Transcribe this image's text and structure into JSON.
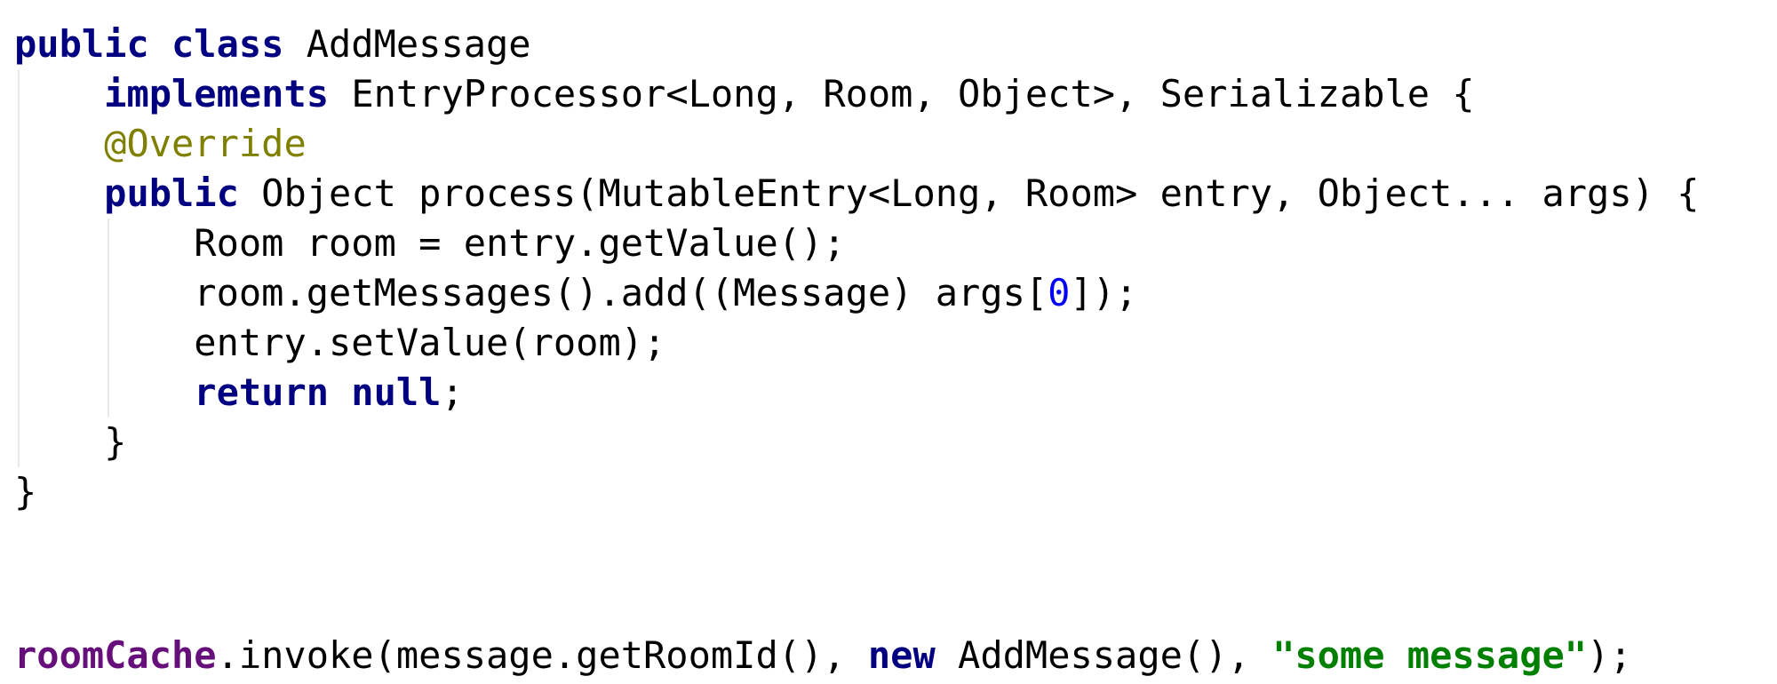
{
  "editor": {
    "theme_colors": {
      "keyword": "#000080",
      "annotation": "#808000",
      "number": "#0000ff",
      "field": "#660e7a",
      "string": "#008000",
      "text": "#000000",
      "background": "#ffffff"
    },
    "class_block": {
      "lines": [
        {
          "tokens": [
            {
              "t": "kw",
              "v": "public class "
            },
            {
              "t": "txt",
              "v": "AddMessage"
            }
          ],
          "indent": 0
        },
        {
          "tokens": [
            {
              "t": "kw",
              "v": "implements "
            },
            {
              "t": "txt",
              "v": "EntryProcessor<Long, Room, Object>, Serializable {"
            }
          ],
          "indent": 1
        },
        {
          "tokens": [
            {
              "t": "ann",
              "v": "@Override"
            }
          ],
          "indent": 1
        },
        {
          "tokens": [
            {
              "t": "kw",
              "v": "public "
            },
            {
              "t": "txt",
              "v": "Object process(MutableEntry<Long, Room> entry, Object... args) {"
            }
          ],
          "indent": 1
        },
        {
          "tokens": [
            {
              "t": "txt",
              "v": "Room room = entry.getValue();"
            }
          ],
          "indent": 2
        },
        {
          "tokens": [
            {
              "t": "txt",
              "v": "room.getMessages().add((Message) args["
            },
            {
              "t": "num",
              "v": "0"
            },
            {
              "t": "txt",
              "v": "]);"
            }
          ],
          "indent": 2
        },
        {
          "tokens": [
            {
              "t": "txt",
              "v": "entry.setValue(room);"
            }
          ],
          "indent": 2
        },
        {
          "tokens": [
            {
              "t": "kw",
              "v": "return null"
            },
            {
              "t": "txt",
              "v": ";"
            }
          ],
          "indent": 2
        },
        {
          "tokens": [
            {
              "t": "txt",
              "v": "}"
            }
          ],
          "indent": 1
        },
        {
          "tokens": [
            {
              "t": "txt",
              "v": "}"
            }
          ],
          "indent": 0
        }
      ]
    },
    "usage_line": {
      "tokens": [
        {
          "t": "field",
          "v": "roomCache"
        },
        {
          "t": "txt",
          "v": ".invoke(message.getRoomId(), "
        },
        {
          "t": "kw",
          "v": "new "
        },
        {
          "t": "txt",
          "v": "AddMessage(), "
        },
        {
          "t": "str",
          "v": "\"some message\""
        },
        {
          "t": "txt",
          "v": ");"
        }
      ]
    }
  }
}
